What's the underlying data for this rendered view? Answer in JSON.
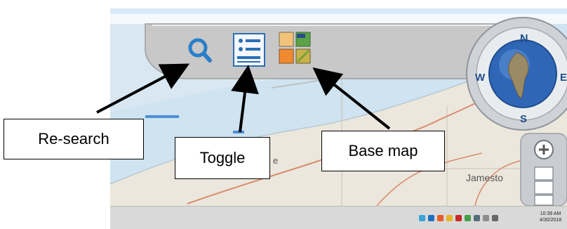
{
  "toolbar": {
    "search_icon": "search-icon",
    "toggle_icon": "list-toggle-icon",
    "basemap_icon": "basemap-grid-icon"
  },
  "compass": {
    "north": "N",
    "east": "E",
    "south": "S",
    "west": "W"
  },
  "zoom": {
    "zoom_in_icon": "plus-icon"
  },
  "map": {
    "place_label": "Jamesto",
    "place_label_partial": "e"
  },
  "callouts": {
    "research": "Re-search",
    "toggle": "Toggle",
    "basemap": "Base map"
  },
  "taskbar": {
    "time": "10:39 AM",
    "date": "4/30/2018"
  },
  "colors": {
    "search_blue": "#2a7fc9",
    "water": "#cfe3f1",
    "land": "#ebe6dc",
    "road": "#d98d6e",
    "toolbar": "#c9c9c9"
  }
}
